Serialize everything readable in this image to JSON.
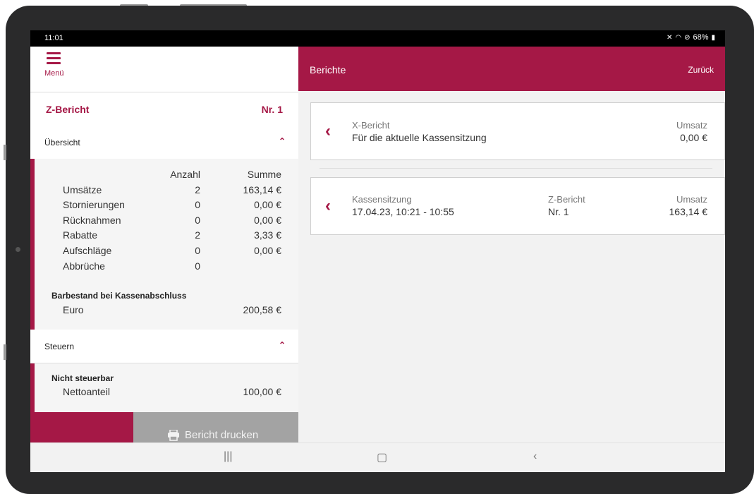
{
  "status": {
    "time": "11:01",
    "icons": [
      "mute-icon",
      "wifi-icon",
      "do-not-disturb-icon",
      "battery-icon"
    ],
    "battery_text": "68%"
  },
  "left": {
    "menu_label": "Menü",
    "report_title": "Z-Bericht",
    "report_number": "Nr. 1",
    "overview_label": "Übersicht",
    "columns": {
      "count": "Anzahl",
      "sum": "Summe"
    },
    "rows": [
      {
        "label": "Umsätze",
        "count": "2",
        "sum": "163,14 €"
      },
      {
        "label": "Stornierungen",
        "count": "0",
        "sum": "0,00 €"
      },
      {
        "label": "Rücknahmen",
        "count": "0",
        "sum": "0,00 €"
      },
      {
        "label": "Rabatte",
        "count": "2",
        "sum": "3,33 €"
      },
      {
        "label": "Aufschläge",
        "count": "0",
        "sum": "0,00 €"
      },
      {
        "label": "Abbrüche",
        "count": "0",
        "sum": ""
      }
    ],
    "cash_title": "Barbestand bei Kassenabschluss",
    "cash_row": {
      "label": "Euro",
      "value": "200,58 €"
    },
    "tax_label": "Steuern",
    "tax_sub_title": "Nicht steuerbar",
    "tax_row": {
      "label": "Nettoanteil",
      "value": "100,00 €"
    },
    "print_label": "Bericht drucken"
  },
  "right": {
    "title": "Berichte",
    "back_label": "Zurück",
    "cards": [
      {
        "label1": "X-Bericht",
        "value1": "Für die aktuelle Kassensitzung",
        "label3": "Umsatz",
        "value3": "0,00 €"
      },
      {
        "label1": "Kassensitzung",
        "value1": "17.04.23, 10:21 - 10:55",
        "label2": "Z-Bericht",
        "value2": "Nr. 1",
        "label3": "Umsatz",
        "value3": "163,14 €"
      }
    ]
  },
  "colors": {
    "accent": "#a51846",
    "print_button": "#a3a3a3"
  }
}
